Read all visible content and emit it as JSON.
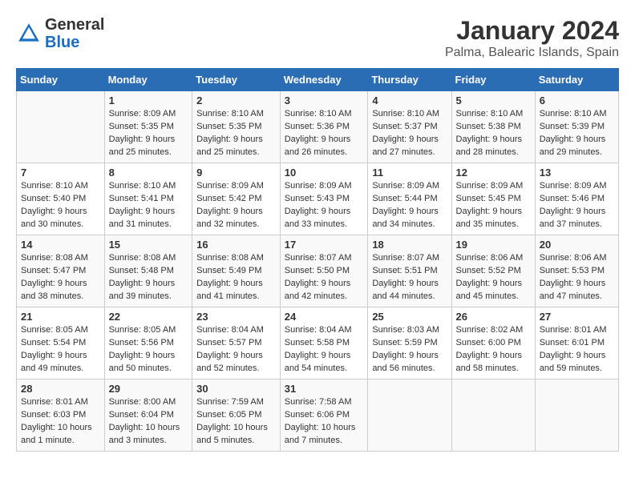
{
  "header": {
    "logo_general": "General",
    "logo_blue": "Blue",
    "main_title": "January 2024",
    "subtitle": "Palma, Balearic Islands, Spain"
  },
  "days_of_week": [
    "Sunday",
    "Monday",
    "Tuesday",
    "Wednesday",
    "Thursday",
    "Friday",
    "Saturday"
  ],
  "weeks": [
    [
      {
        "day": "",
        "info": ""
      },
      {
        "day": "1",
        "info": "Sunrise: 8:09 AM\nSunset: 5:35 PM\nDaylight: 9 hours\nand 25 minutes."
      },
      {
        "day": "2",
        "info": "Sunrise: 8:10 AM\nSunset: 5:35 PM\nDaylight: 9 hours\nand 25 minutes."
      },
      {
        "day": "3",
        "info": "Sunrise: 8:10 AM\nSunset: 5:36 PM\nDaylight: 9 hours\nand 26 minutes."
      },
      {
        "day": "4",
        "info": "Sunrise: 8:10 AM\nSunset: 5:37 PM\nDaylight: 9 hours\nand 27 minutes."
      },
      {
        "day": "5",
        "info": "Sunrise: 8:10 AM\nSunset: 5:38 PM\nDaylight: 9 hours\nand 28 minutes."
      },
      {
        "day": "6",
        "info": "Sunrise: 8:10 AM\nSunset: 5:39 PM\nDaylight: 9 hours\nand 29 minutes."
      }
    ],
    [
      {
        "day": "7",
        "info": "Sunrise: 8:10 AM\nSunset: 5:40 PM\nDaylight: 9 hours\nand 30 minutes."
      },
      {
        "day": "8",
        "info": "Sunrise: 8:10 AM\nSunset: 5:41 PM\nDaylight: 9 hours\nand 31 minutes."
      },
      {
        "day": "9",
        "info": "Sunrise: 8:09 AM\nSunset: 5:42 PM\nDaylight: 9 hours\nand 32 minutes."
      },
      {
        "day": "10",
        "info": "Sunrise: 8:09 AM\nSunset: 5:43 PM\nDaylight: 9 hours\nand 33 minutes."
      },
      {
        "day": "11",
        "info": "Sunrise: 8:09 AM\nSunset: 5:44 PM\nDaylight: 9 hours\nand 34 minutes."
      },
      {
        "day": "12",
        "info": "Sunrise: 8:09 AM\nSunset: 5:45 PM\nDaylight: 9 hours\nand 35 minutes."
      },
      {
        "day": "13",
        "info": "Sunrise: 8:09 AM\nSunset: 5:46 PM\nDaylight: 9 hours\nand 37 minutes."
      }
    ],
    [
      {
        "day": "14",
        "info": "Sunrise: 8:08 AM\nSunset: 5:47 PM\nDaylight: 9 hours\nand 38 minutes."
      },
      {
        "day": "15",
        "info": "Sunrise: 8:08 AM\nSunset: 5:48 PM\nDaylight: 9 hours\nand 39 minutes."
      },
      {
        "day": "16",
        "info": "Sunrise: 8:08 AM\nSunset: 5:49 PM\nDaylight: 9 hours\nand 41 minutes."
      },
      {
        "day": "17",
        "info": "Sunrise: 8:07 AM\nSunset: 5:50 PM\nDaylight: 9 hours\nand 42 minutes."
      },
      {
        "day": "18",
        "info": "Sunrise: 8:07 AM\nSunset: 5:51 PM\nDaylight: 9 hours\nand 44 minutes."
      },
      {
        "day": "19",
        "info": "Sunrise: 8:06 AM\nSunset: 5:52 PM\nDaylight: 9 hours\nand 45 minutes."
      },
      {
        "day": "20",
        "info": "Sunrise: 8:06 AM\nSunset: 5:53 PM\nDaylight: 9 hours\nand 47 minutes."
      }
    ],
    [
      {
        "day": "21",
        "info": "Sunrise: 8:05 AM\nSunset: 5:54 PM\nDaylight: 9 hours\nand 49 minutes."
      },
      {
        "day": "22",
        "info": "Sunrise: 8:05 AM\nSunset: 5:56 PM\nDaylight: 9 hours\nand 50 minutes."
      },
      {
        "day": "23",
        "info": "Sunrise: 8:04 AM\nSunset: 5:57 PM\nDaylight: 9 hours\nand 52 minutes."
      },
      {
        "day": "24",
        "info": "Sunrise: 8:04 AM\nSunset: 5:58 PM\nDaylight: 9 hours\nand 54 minutes."
      },
      {
        "day": "25",
        "info": "Sunrise: 8:03 AM\nSunset: 5:59 PM\nDaylight: 9 hours\nand 56 minutes."
      },
      {
        "day": "26",
        "info": "Sunrise: 8:02 AM\nSunset: 6:00 PM\nDaylight: 9 hours\nand 58 minutes."
      },
      {
        "day": "27",
        "info": "Sunrise: 8:01 AM\nSunset: 6:01 PM\nDaylight: 9 hours\nand 59 minutes."
      }
    ],
    [
      {
        "day": "28",
        "info": "Sunrise: 8:01 AM\nSunset: 6:03 PM\nDaylight: 10 hours\nand 1 minute."
      },
      {
        "day": "29",
        "info": "Sunrise: 8:00 AM\nSunset: 6:04 PM\nDaylight: 10 hours\nand 3 minutes."
      },
      {
        "day": "30",
        "info": "Sunrise: 7:59 AM\nSunset: 6:05 PM\nDaylight: 10 hours\nand 5 minutes."
      },
      {
        "day": "31",
        "info": "Sunrise: 7:58 AM\nSunset: 6:06 PM\nDaylight: 10 hours\nand 7 minutes."
      },
      {
        "day": "",
        "info": ""
      },
      {
        "day": "",
        "info": ""
      },
      {
        "day": "",
        "info": ""
      }
    ]
  ]
}
